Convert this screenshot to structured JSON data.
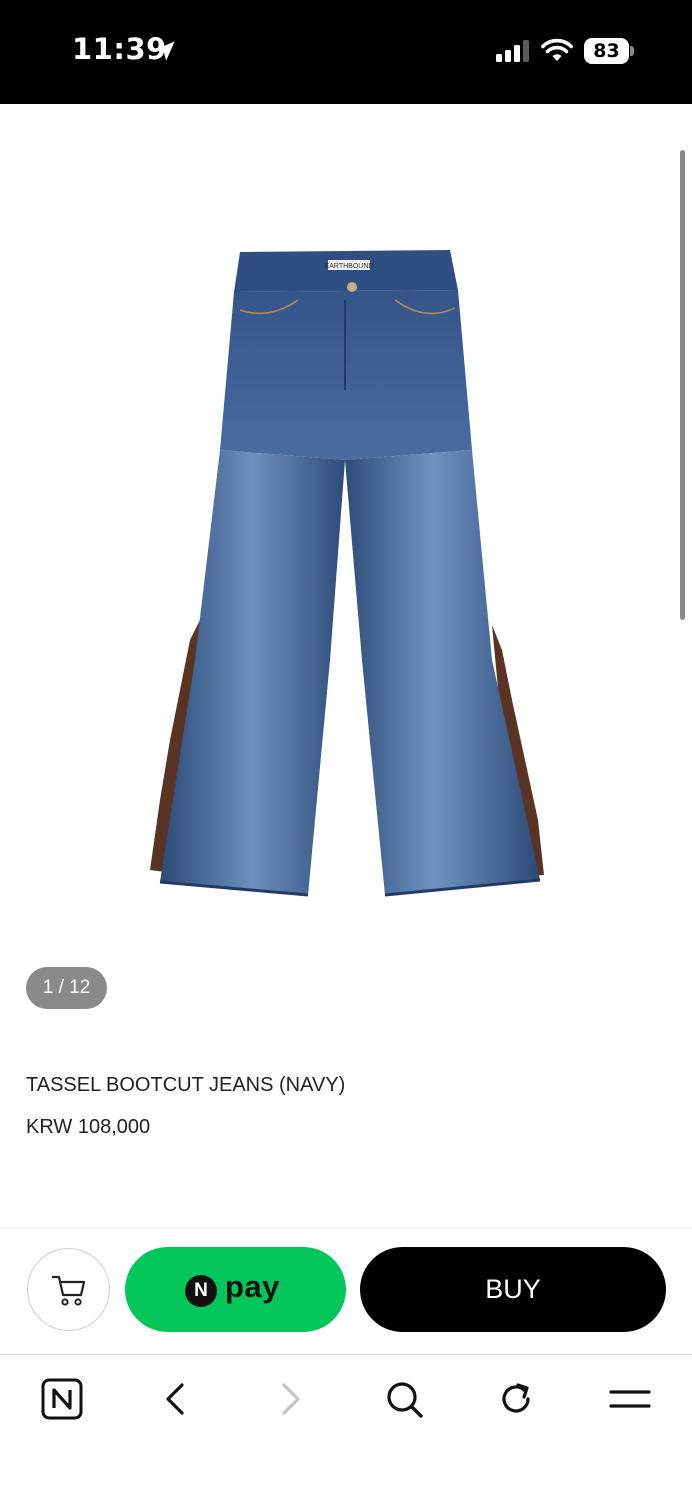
{
  "status_bar": {
    "time": "11:39",
    "battery": "83",
    "icons": [
      "location-arrow-icon",
      "cellular-signal-icon",
      "wifi-icon",
      "battery-icon"
    ]
  },
  "gallery": {
    "counter": "1 / 12",
    "image_label": "EARTHBOUND"
  },
  "product": {
    "name": "TASSEL BOOTCUT JEANS (NAVY)",
    "price": "KRW 108,000"
  },
  "purchase_bar": {
    "cart_icon": "cart-icon",
    "npay_logo": "N",
    "npay_label": "pay",
    "buy_label": "BUY"
  },
  "browser_toolbar": {
    "icons": [
      "naver-home-icon",
      "back-arrow-icon",
      "forward-arrow-icon",
      "search-icon",
      "reload-icon",
      "menu-icon"
    ]
  },
  "colors": {
    "npay_green": "#03c75a",
    "buy_black": "#000000",
    "badge_gray": "#8a8a8a",
    "denim_blue": "#3d5f8e",
    "tassel_brown": "#5a3422"
  }
}
